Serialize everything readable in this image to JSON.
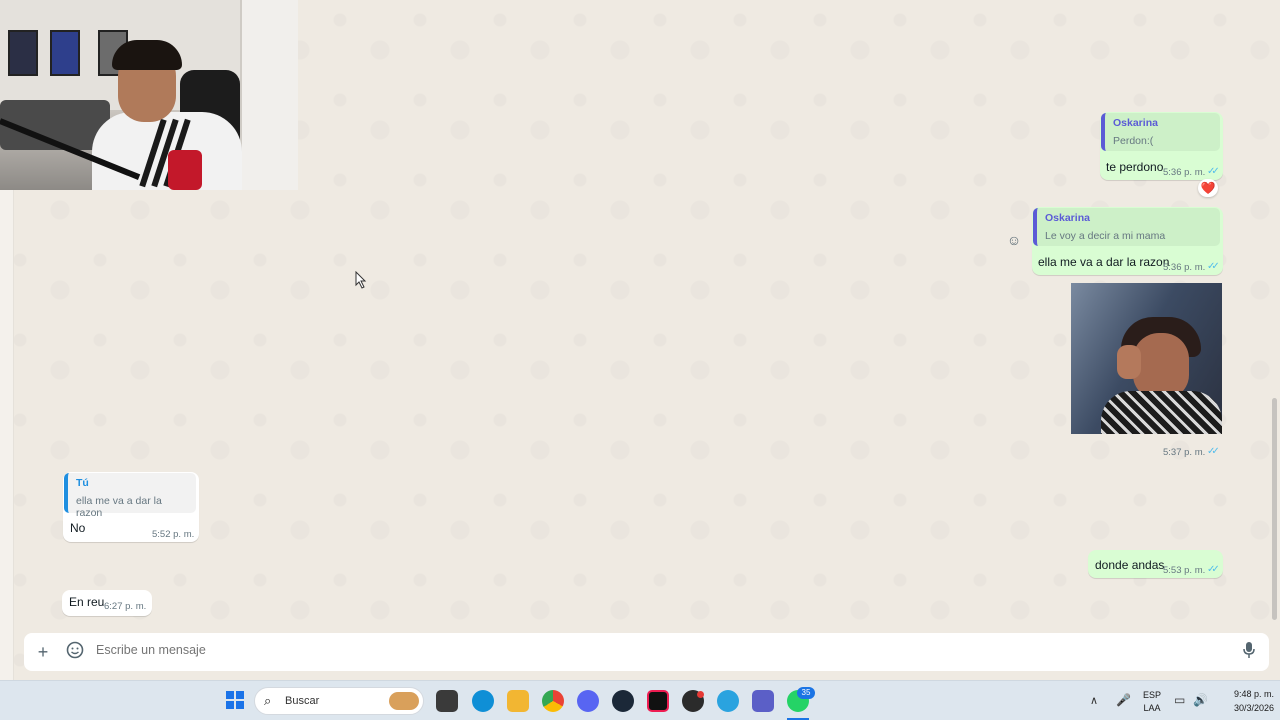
{
  "messages": {
    "m1": {
      "quote_author": "Oskarina",
      "quote_text": "Perdon:(",
      "text": "te perdono",
      "time": "5:36 p. m.",
      "reaction": "❤️"
    },
    "m2": {
      "quote_author": "Oskarina",
      "quote_text": "Le voy a decir a mi mama",
      "text": "ella me va a dar la razon",
      "time": "5:36 p. m."
    },
    "m3": {
      "time": "5:37 p. m."
    },
    "m4": {
      "quote_author": "Tú",
      "quote_text": "ella me va a dar la razon",
      "text": "No",
      "time": "5:52 p. m."
    },
    "m5": {
      "text": "donde andas",
      "time": "5:53 p. m."
    },
    "m6": {
      "text": "En reu",
      "time": "6:27 p. m."
    }
  },
  "composer": {
    "placeholder": "Escribe un mensaje"
  },
  "taskbar": {
    "search_label": "Buscar",
    "whatsapp_badge": "35",
    "lang_line1": "ESP",
    "lang_line2": "LAA",
    "clock_time": "9:48 p. m.",
    "clock_date": "30/3/2026"
  },
  "icons": [
    "plus-icon",
    "sticker-icon",
    "mic-icon",
    "windows-start-icon",
    "search-icon",
    "file-explorer-icon",
    "edge-icon",
    "folder-icon",
    "chrome-icon",
    "discord-icon",
    "steam-icon",
    "tiktok-icon",
    "obs-icon",
    "telegram-icon",
    "teams-icon",
    "whatsapp-icon"
  ],
  "colors": {
    "outgoing_bubble": "#d9fdd3",
    "incoming_bubble": "#ffffff",
    "chat_bg": "#efeae2",
    "read_ticks": "#53bdeb",
    "quote_bar": "#5b5bd6"
  }
}
